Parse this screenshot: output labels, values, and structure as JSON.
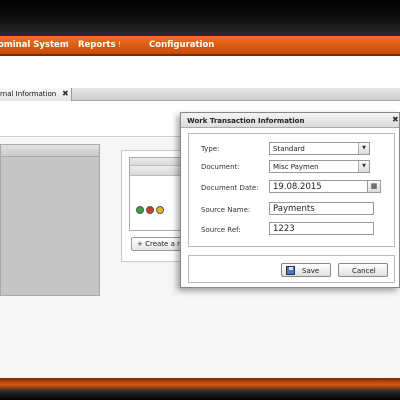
{
  "nav": {
    "items": [
      "ominal System",
      "Reports",
      "Configuration"
    ],
    "separators": [
      "!",
      "!"
    ]
  },
  "tab": {
    "label": "rnal Information",
    "close": "✖"
  },
  "workspace": {
    "create_label": "+ Create a n",
    "status_colors": [
      "#3aa53a",
      "#d03a2a",
      "#e5b820"
    ]
  },
  "dialog": {
    "title": "Work Transaction Information",
    "close": "✖",
    "fields": {
      "type_label": "Type:",
      "type_value": "Standard",
      "document_label": "Document:",
      "document_value": "Misc Paymen",
      "date_label": "Document Date:",
      "date_value": "19.08.2015",
      "source_name_label": "Source Name:",
      "source_name_value": "Payments",
      "source_ref_label": "Source Ref:",
      "source_ref_value": "1223"
    },
    "save_label": "Save",
    "cancel_label": "Cancel"
  },
  "icons": {
    "dropdown": "chevron-down-icon",
    "calendar": "calendar-icon",
    "save": "floppy-disk-icon"
  },
  "colors": {
    "accent": "#e0601a",
    "nav_text": "#ffffff"
  }
}
